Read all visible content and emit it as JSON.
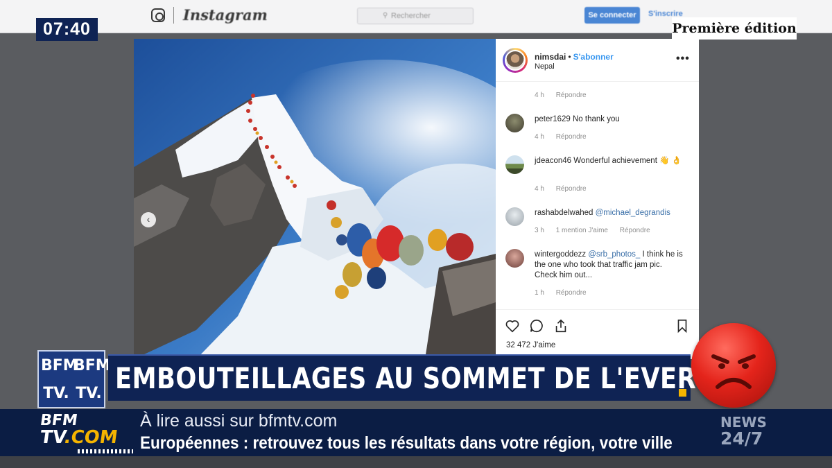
{
  "broadcast": {
    "clock": "07:40",
    "edition": "Première édition",
    "headline": "EMBOUTEILLAGES AU SOMMET DE L'EVEREST",
    "brand_tl": "BFM",
    "brand_tr": "BFM",
    "brand_bl": "TV.",
    "brand_br": "TV.",
    "ticker": {
      "line1": "À lire aussi sur bfmtv.com",
      "line2": "Européennes : retrouvez tous les résultats dans votre région, votre ville"
    },
    "site_logo": {
      "top": "BFM",
      "bottom": "TV",
      "suffix": ".COM"
    },
    "news_badge": {
      "line1": "NEWS",
      "line2": "24/7"
    },
    "colors": {
      "navy": "#0f2354",
      "accent": "#f4b400",
      "emoji_red": "#e4241b"
    }
  },
  "instagram": {
    "wordmark": "Instagram",
    "search_placeholder": "Rechercher",
    "login_label": "Se connecter",
    "signup_label": "S'inscrire",
    "post": {
      "username": "nimsdai",
      "follow_label": "S'abonner",
      "location": "Nepal",
      "likes": "32 472 J'aime",
      "top_meta": {
        "time": "4 h",
        "reply": "Répondre"
      },
      "comments": [
        {
          "user": "peter1629",
          "text": "No thank you",
          "time": "4 h",
          "likes": "",
          "reply": "Répondre"
        },
        {
          "user": "jdeacon46",
          "text": "Wonderful achievement 👋 👌",
          "time": "4 h",
          "likes": "",
          "reply": "Répondre"
        },
        {
          "user": "rashabdelwahed",
          "mention": "@michael_degrandis",
          "text": "",
          "time": "3 h",
          "likes": "1 mention J'aime",
          "reply": "Répondre"
        },
        {
          "user": "wintergoddezz",
          "mention": "@srb_photos_",
          "text": "I think he is the one who took that traffic jam pic. Check him out...",
          "time": "1 h",
          "likes": "",
          "reply": "Répondre"
        }
      ]
    }
  }
}
